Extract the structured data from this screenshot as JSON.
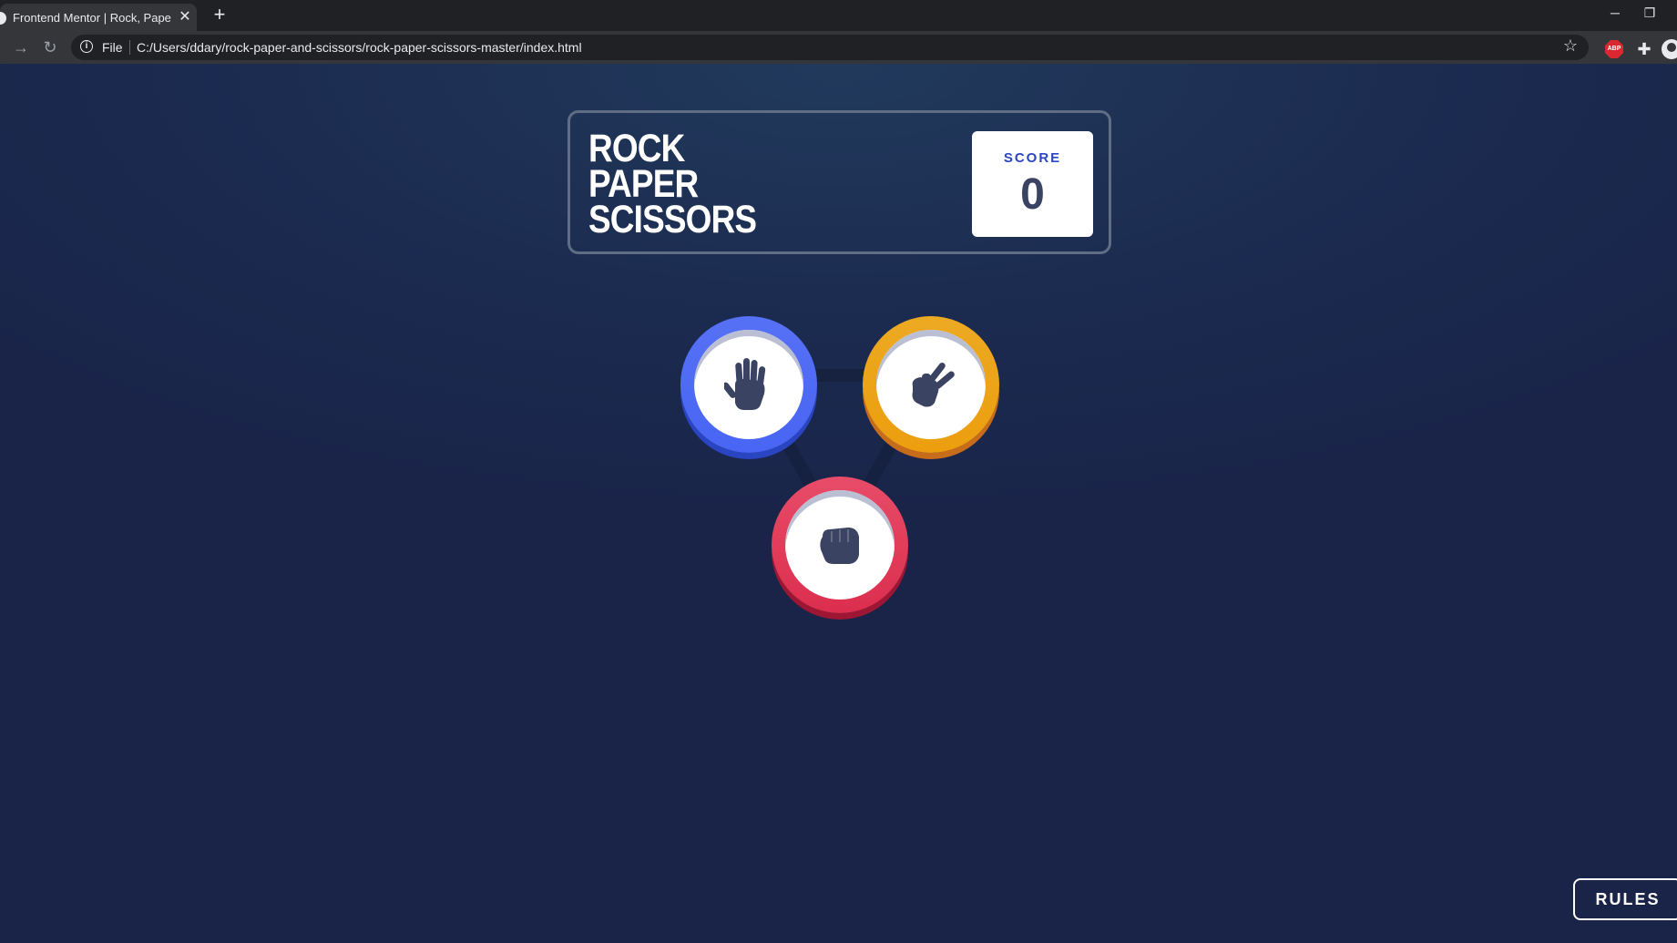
{
  "browser": {
    "tab_title": "Frontend Mentor | Rock, Paper, S",
    "tab_close": "✕",
    "new_tab": "+",
    "window_minimize": "─",
    "window_restore": "❐",
    "scheme_label": "File",
    "url": "C:/Users/ddary/rock-paper-and-scissors/rock-paper-scissors-master/index.html",
    "extension_abp": "ABP"
  },
  "game": {
    "title_lines": [
      "ROCK",
      "PAPER",
      "SCISSORS"
    ],
    "score_label": "SCORE",
    "score_value": "0",
    "choices": [
      {
        "name": "paper",
        "icon": "paper-hand-icon",
        "color": "#4865f4"
      },
      {
        "name": "scissors",
        "icon": "scissors-hand-icon",
        "color": "#ec9e0e"
      },
      {
        "name": "rock",
        "icon": "rock-fist-icon",
        "color": "#dc2e4e"
      }
    ],
    "rules_label": "RULES"
  },
  "colors": {
    "background": "#1f3756",
    "header_outline": "#606e85",
    "score_text": "#2a46c0",
    "dark_text": "#3b4363"
  }
}
